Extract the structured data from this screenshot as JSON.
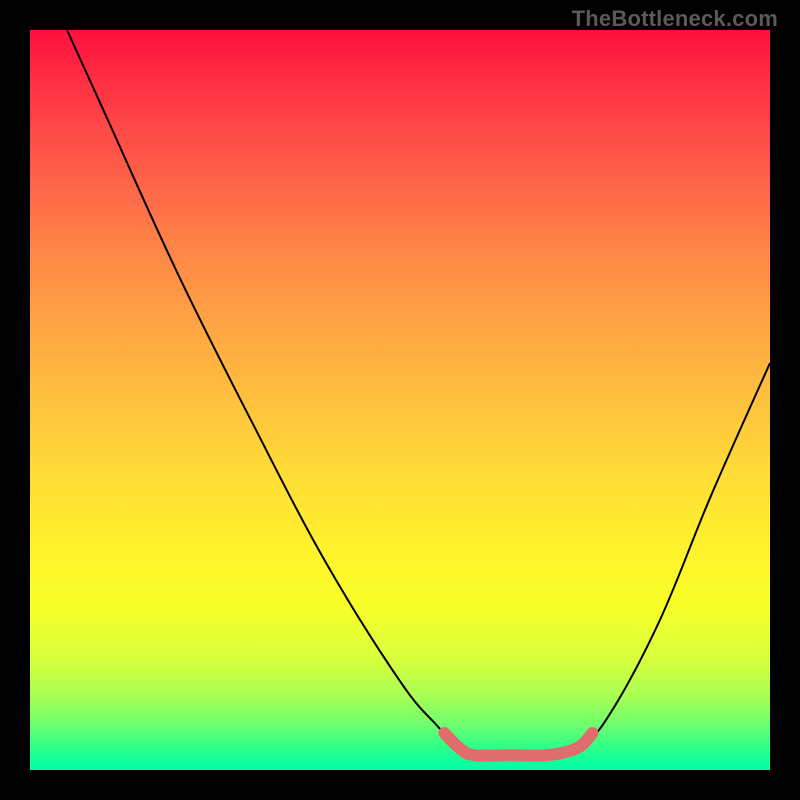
{
  "watermark": "TheBottleneck.com",
  "chart_data": {
    "type": "line",
    "title": "",
    "xlabel": "",
    "ylabel": "",
    "xlim": [
      0,
      100
    ],
    "ylim": [
      0,
      100
    ],
    "gradient_stops": [
      {
        "pos": 0,
        "color": "#ff0f3f"
      },
      {
        "pos": 6,
        "color": "#ff2b42"
      },
      {
        "pos": 13,
        "color": "#ff4747"
      },
      {
        "pos": 22,
        "color": "#ff6948"
      },
      {
        "pos": 30,
        "color": "#ff8746"
      },
      {
        "pos": 40,
        "color": "#ffa443"
      },
      {
        "pos": 50,
        "color": "#ffc13e"
      },
      {
        "pos": 60,
        "color": "#ffdc37"
      },
      {
        "pos": 70,
        "color": "#fff22c"
      },
      {
        "pos": 78,
        "color": "#f8ff28"
      },
      {
        "pos": 85,
        "color": "#d7ff3d"
      },
      {
        "pos": 90,
        "color": "#a8ff55"
      },
      {
        "pos": 94,
        "color": "#6bff6e"
      },
      {
        "pos": 97,
        "color": "#2cff89"
      },
      {
        "pos": 100,
        "color": "#00ffa9"
      }
    ],
    "series": [
      {
        "name": "bottleneck-curve-thin",
        "stroke": "#000000",
        "stroke_width": 2,
        "points": [
          {
            "x": 5,
            "y": 100
          },
          {
            "x": 10,
            "y": 89
          },
          {
            "x": 20,
            "y": 67
          },
          {
            "x": 30,
            "y": 47
          },
          {
            "x": 40,
            "y": 28
          },
          {
            "x": 50,
            "y": 12
          },
          {
            "x": 55,
            "y": 6
          },
          {
            "x": 58,
            "y": 3
          },
          {
            "x": 60,
            "y": 2
          },
          {
            "x": 65,
            "y": 2
          },
          {
            "x": 70,
            "y": 2
          },
          {
            "x": 74,
            "y": 3
          },
          {
            "x": 78,
            "y": 7
          },
          {
            "x": 85,
            "y": 20
          },
          {
            "x": 92,
            "y": 37
          },
          {
            "x": 100,
            "y": 55
          }
        ]
      },
      {
        "name": "bottleneck-curve-highlight",
        "stroke": "#e06c6c",
        "stroke_width": 12,
        "points": [
          {
            "x": 56,
            "y": 5
          },
          {
            "x": 58,
            "y": 3
          },
          {
            "x": 60,
            "y": 2
          },
          {
            "x": 65,
            "y": 2
          },
          {
            "x": 70,
            "y": 2
          },
          {
            "x": 74,
            "y": 3
          },
          {
            "x": 76,
            "y": 5
          }
        ]
      }
    ]
  }
}
